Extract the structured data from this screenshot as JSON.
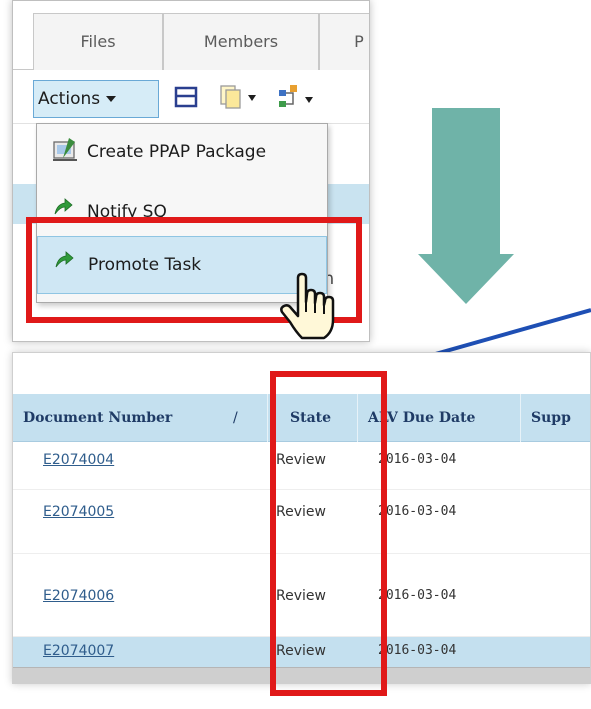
{
  "tabs": [
    {
      "label": "Files"
    },
    {
      "label": "Members"
    },
    {
      "label": "P"
    }
  ],
  "toolbar": {
    "actions_label": "Actions"
  },
  "actions_menu": {
    "items": [
      {
        "label": "Create PPAP Package",
        "icon": "ppap-package-icon"
      },
      {
        "label": "Notify SQ",
        "icon": "notify-arrow-icon"
      },
      {
        "label": "Promote Task",
        "icon": "promote-arrow-icon",
        "highlighted": true
      }
    ]
  },
  "background_partial_text": "on",
  "table": {
    "columns": [
      {
        "label": "Document Number",
        "sort": "/"
      },
      {
        "label": "State"
      },
      {
        "label": "ALV Due Date"
      },
      {
        "label": "Supp"
      }
    ],
    "rows": [
      {
        "document_number": "E2074004",
        "state": "Review",
        "alv_due_date": "2016-03-04"
      },
      {
        "document_number": "E2074005",
        "state": "Review",
        "alv_due_date": "2016-03-04"
      },
      {
        "document_number": "E2074006",
        "state": "Review",
        "alv_due_date": "2016-03-04"
      },
      {
        "document_number": "E2074007",
        "state": "Review",
        "alv_due_date": "2016-03-04"
      }
    ]
  },
  "colors": {
    "highlight_red": "#e01919",
    "arrow_teal": "#6fb3a8",
    "pointer_blue": "#1e4fb4",
    "header_blue": "#c4e0ef",
    "link_blue": "#2f5d8c"
  }
}
